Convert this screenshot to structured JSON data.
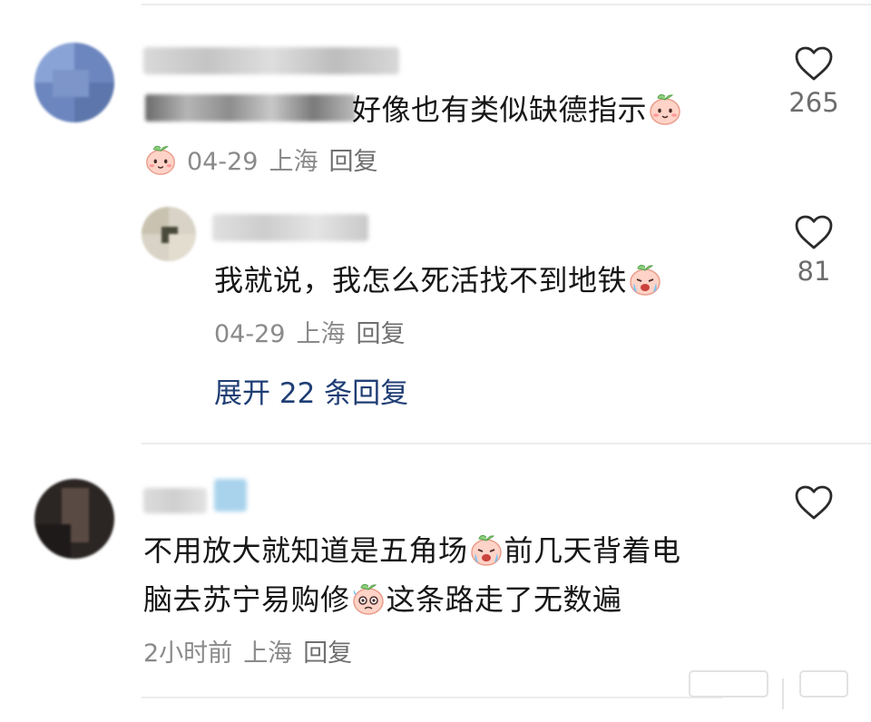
{
  "comments": [
    {
      "text_visible": "好像也有类似缺德指示",
      "date": "04-29",
      "location": "上海",
      "reply_label": "回复",
      "likes": "265",
      "replies": [
        {
          "text": "我就说，我怎么死活找不到地铁",
          "date": "04-29",
          "location": "上海",
          "reply_label": "回复",
          "likes": "81"
        }
      ],
      "expand_label": "展开 22 条回复"
    },
    {
      "text_line1": "不用放大就知道是五角场",
      "text_line1b": "前几天背着电",
      "text_line2a": "脑去苏宁易购修",
      "text_line2b": "这条路走了无数遍",
      "date": "2小时前",
      "location": "上海",
      "reply_label": "回复"
    }
  ],
  "icons": {
    "like": "heart-outline-icon",
    "emoji": "peach-face-emoji"
  },
  "colors": {
    "accent_link": "#1f3e74",
    "meta": "#8a8a8a",
    "divider": "#ececec"
  }
}
